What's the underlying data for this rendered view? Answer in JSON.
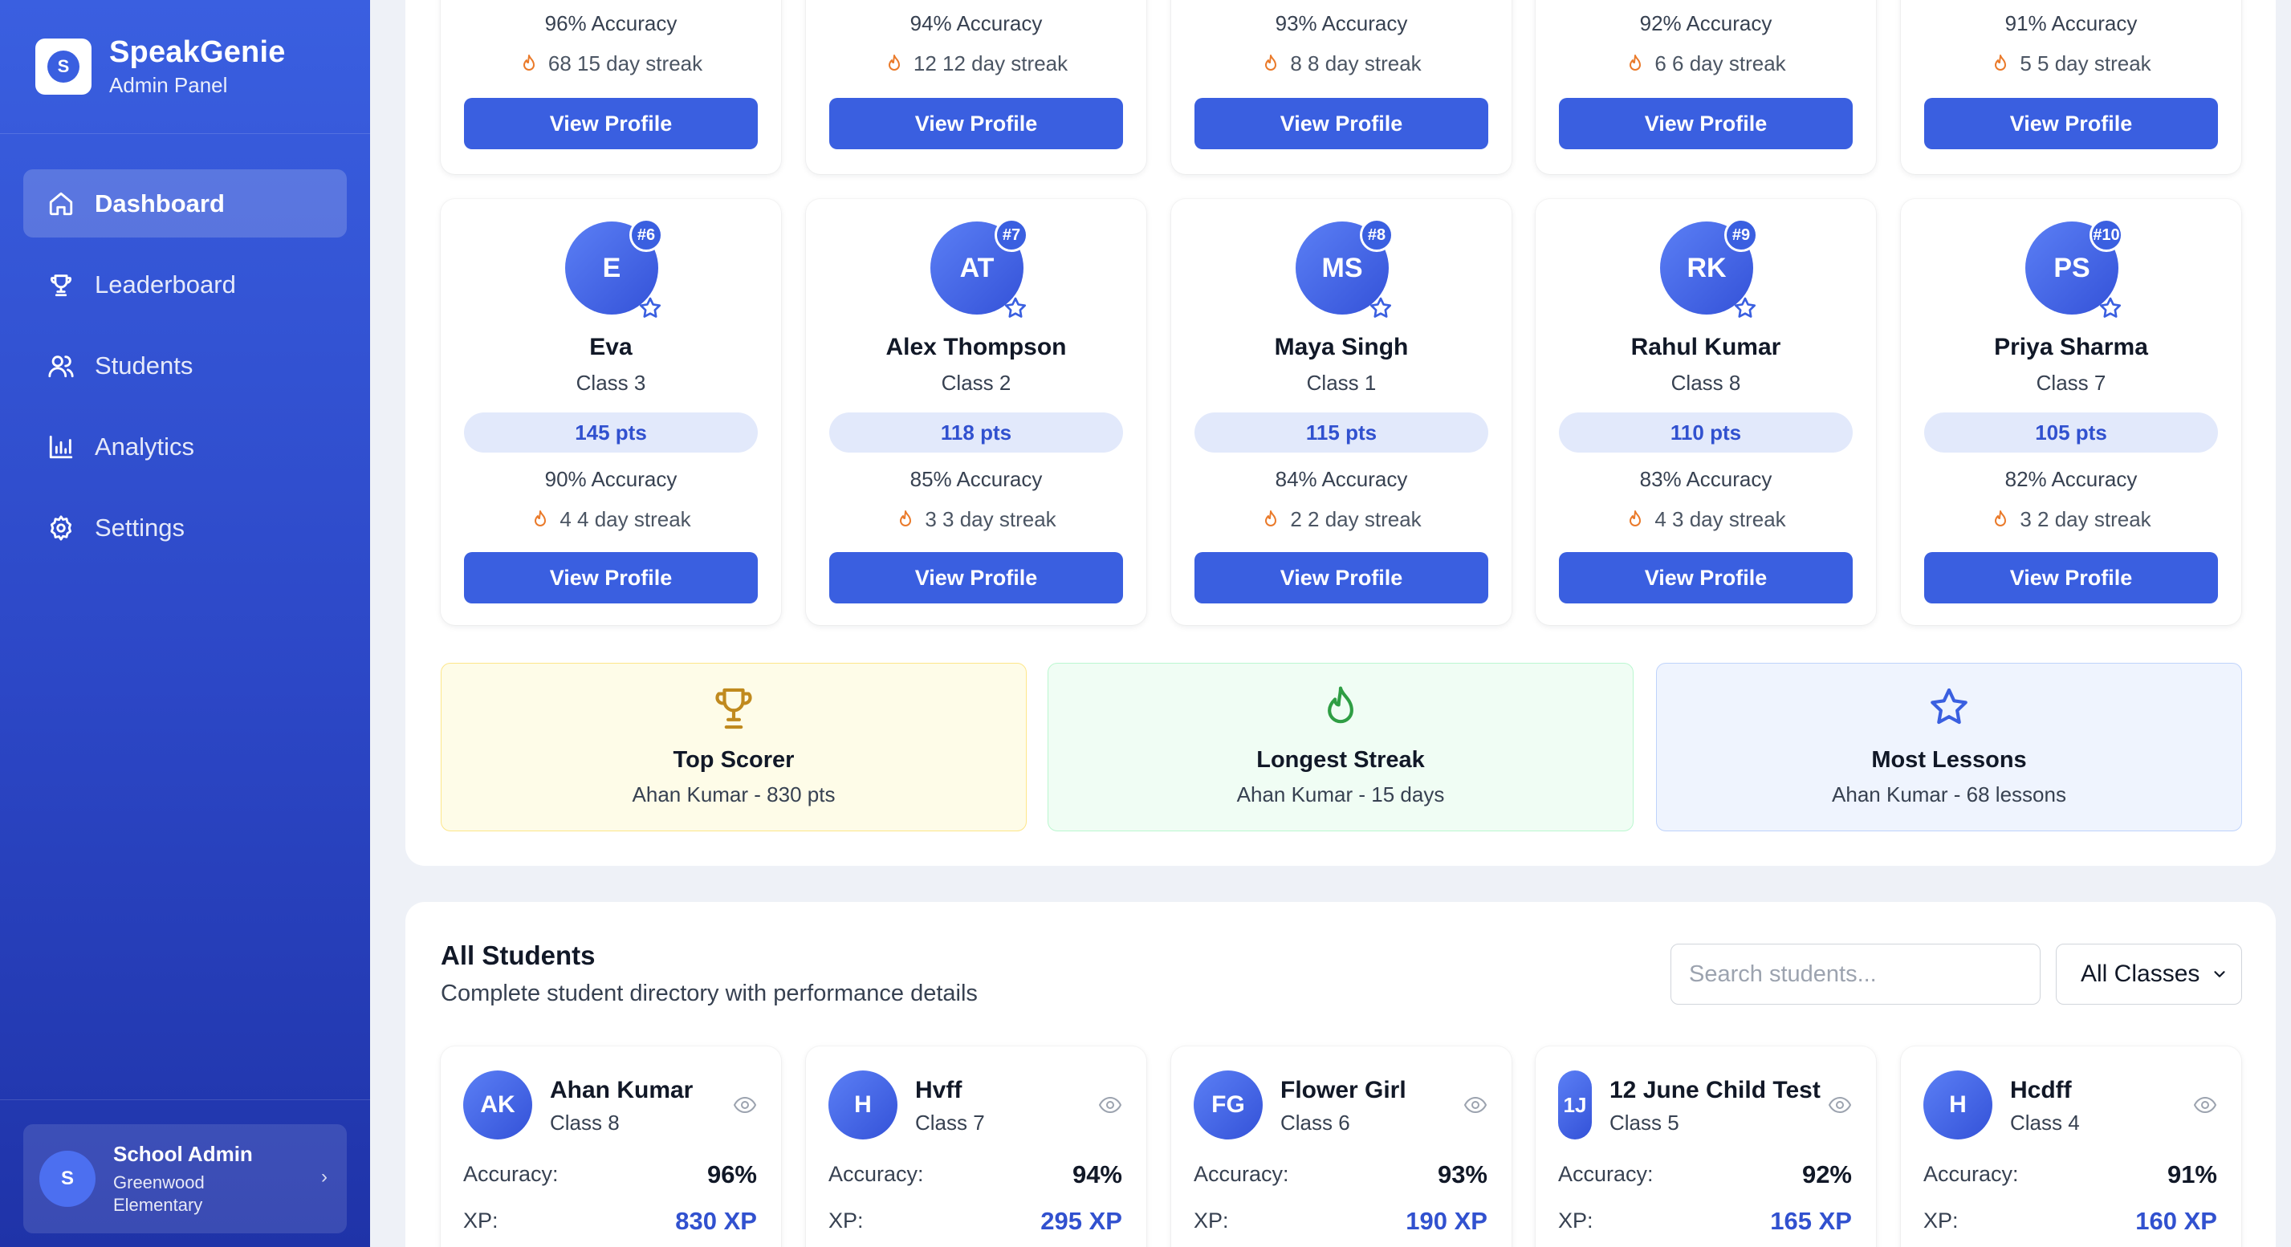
{
  "brand": {
    "title": "SpeakGenie",
    "subtitle": "Admin Panel",
    "logo_letter": "S"
  },
  "nav": [
    {
      "label": "Dashboard",
      "icon": "home-icon",
      "active": true
    },
    {
      "label": "Leaderboard",
      "icon": "trophy-icon",
      "active": false
    },
    {
      "label": "Students",
      "icon": "users-icon",
      "active": false
    },
    {
      "label": "Analytics",
      "icon": "bar-chart-icon",
      "active": false
    },
    {
      "label": "Settings",
      "icon": "gear-icon",
      "active": false
    }
  ],
  "user": {
    "initial": "S",
    "name": "School Admin",
    "school": "Greenwood Elementary"
  },
  "top_row": [
    {
      "accuracy": "96% Accuracy",
      "streak": "68 15 day streak",
      "button": "View Profile"
    },
    {
      "accuracy": "94% Accuracy",
      "streak": "12 12 day streak",
      "button": "View Profile"
    },
    {
      "accuracy": "93% Accuracy",
      "streak": "8 8 day streak",
      "button": "View Profile"
    },
    {
      "accuracy": "92% Accuracy",
      "streak": "6 6 day streak",
      "button": "View Profile"
    },
    {
      "accuracy": "91% Accuracy",
      "streak": "5 5 day streak",
      "button": "View Profile"
    }
  ],
  "leaderboard": [
    {
      "initials": "E",
      "rank": "#6",
      "name": "Eva",
      "class": "Class 3",
      "points": "145 pts",
      "accuracy": "90% Accuracy",
      "streak": "4 4 day streak",
      "button": "View Profile"
    },
    {
      "initials": "AT",
      "rank": "#7",
      "name": "Alex Thompson",
      "class": "Class 2",
      "points": "118 pts",
      "accuracy": "85% Accuracy",
      "streak": "3 3 day streak",
      "button": "View Profile"
    },
    {
      "initials": "MS",
      "rank": "#8",
      "name": "Maya Singh",
      "class": "Class 1",
      "points": "115 pts",
      "accuracy": "84% Accuracy",
      "streak": "2 2 day streak",
      "button": "View Profile"
    },
    {
      "initials": "RK",
      "rank": "#9",
      "name": "Rahul Kumar",
      "class": "Class 8",
      "points": "110 pts",
      "accuracy": "83% Accuracy",
      "streak": "4 3 day streak",
      "button": "View Profile"
    },
    {
      "initials": "PS",
      "rank": "#10",
      "name": "Priya Sharma",
      "class": "Class 7",
      "points": "105 pts",
      "accuracy": "82% Accuracy",
      "streak": "3 2 day streak",
      "button": "View Profile"
    }
  ],
  "achievements": [
    {
      "title": "Top Scorer",
      "detail": "Ahan Kumar - 830 pts",
      "icon": "trophy-icon",
      "bg": "#fefce8",
      "border": "#fde68a",
      "color": "#c08a1e"
    },
    {
      "title": "Longest Streak",
      "detail": "Ahan Kumar - 15 days",
      "icon": "flame-icon",
      "bg": "#f0fdf4",
      "border": "#bbf7d0",
      "color": "#2f9e44"
    },
    {
      "title": "Most Lessons",
      "detail": "Ahan Kumar - 68 lessons",
      "icon": "star-icon",
      "bg": "#eff4fe",
      "border": "#bfd3fb",
      "color": "#3a5fe0"
    }
  ],
  "all_students": {
    "title": "All Students",
    "subtitle": "Complete student directory with performance details",
    "search_placeholder": "Search students...",
    "filter_value": "All Classes",
    "accuracy_label": "Accuracy:",
    "xp_label": "XP:",
    "students": [
      {
        "initials": "AK",
        "name": "Ahan Kumar",
        "class": "Class 8",
        "accuracy": "96%",
        "xp": "830 XP"
      },
      {
        "initials": "H",
        "name": "Hvff",
        "class": "Class 7",
        "accuracy": "94%",
        "xp": "295 XP"
      },
      {
        "initials": "FG",
        "name": "Flower Girl",
        "class": "Class 6",
        "accuracy": "93%",
        "xp": "190 XP"
      },
      {
        "initials": "1J",
        "name": "12 June Child Test",
        "class": "Class 5",
        "accuracy": "92%",
        "xp": "165 XP"
      },
      {
        "initials": "H",
        "name": "Hcdff",
        "class": "Class 4",
        "accuracy": "91%",
        "xp": "160 XP"
      }
    ]
  },
  "colors": {
    "primary": "#3a5fe0",
    "accent_text": "#3151cf",
    "flame": "#ea7a2a"
  }
}
